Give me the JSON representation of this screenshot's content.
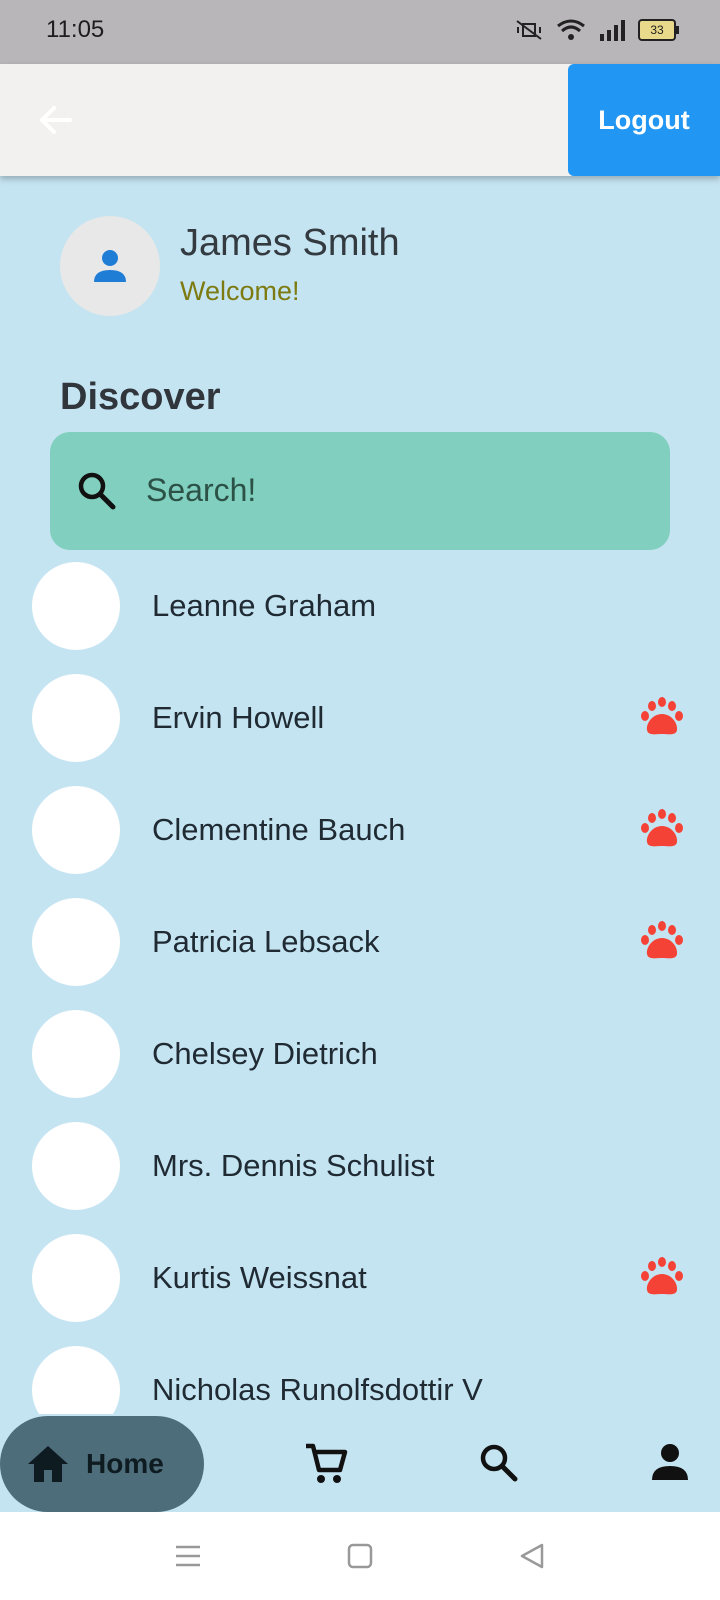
{
  "status_bar": {
    "time": "11:05",
    "battery": "33"
  },
  "app_bar": {
    "logout_label": "Logout"
  },
  "profile": {
    "name": "James Smith",
    "greeting": "Welcome!"
  },
  "discover": {
    "title": "Discover",
    "search_placeholder": "Search!"
  },
  "users": [
    {
      "name": "Leanne Graham",
      "paw": false
    },
    {
      "name": "Ervin Howell",
      "paw": true
    },
    {
      "name": "Clementine Bauch",
      "paw": true
    },
    {
      "name": "Patricia Lebsack",
      "paw": true
    },
    {
      "name": "Chelsey Dietrich",
      "paw": false
    },
    {
      "name": "Mrs. Dennis Schulist",
      "paw": false
    },
    {
      "name": "Kurtis Weissnat",
      "paw": true
    },
    {
      "name": "Nicholas Runolfsdottir V",
      "paw": false
    }
  ],
  "bottom_nav": {
    "home_label": "Home"
  },
  "colors": {
    "accent": "#2196f3",
    "paw": "#f44336",
    "background": "#c5e4f2",
    "search": "#81cfbe"
  },
  "icons": [
    "back-arrow-icon",
    "person-icon",
    "search-icon",
    "paw-icon",
    "home-icon",
    "cart-icon",
    "profile-icon"
  ]
}
